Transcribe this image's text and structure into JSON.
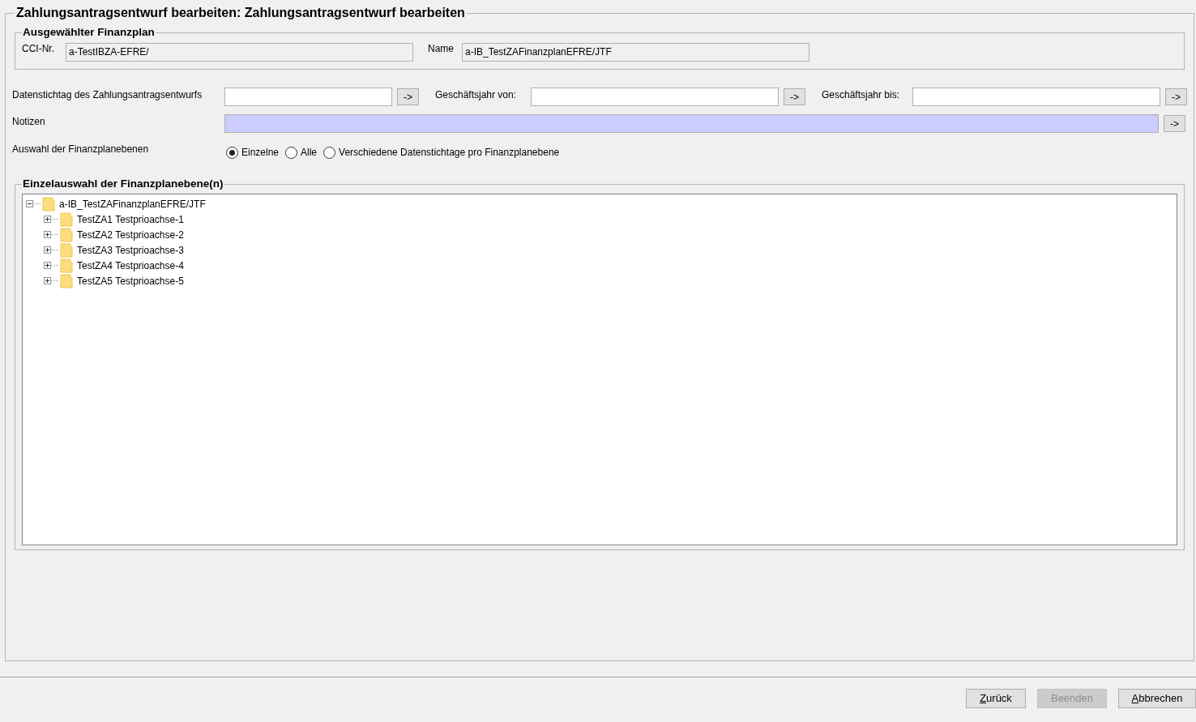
{
  "window": {
    "title": "Zahlungsantragsentwurf bearbeiten: Zahlungsantragsentwurf bearbeiten"
  },
  "selected_plan": {
    "title": "Ausgewählter Finanzplan",
    "cci_label": "CCI-Nr.",
    "cci_value": "a-TestIBZA-EFRE/",
    "name_label": "Name",
    "name_value": "a-IB_TestZAFinanzplanEFRE/JTF"
  },
  "fields": [
    {
      "label": "Datenstichtag des Zahlungsantragsentwurfs",
      "button": "->"
    },
    {
      "label": "Geschäftsjahr von:",
      "button": "->"
    },
    {
      "label": "Geschäftsjahr bis:",
      "button": "->"
    }
  ],
  "notes": {
    "label": "Notizen",
    "button": "->"
  },
  "level_selection": {
    "label": "Auswahl der Finanzplanebenen",
    "options": [
      {
        "label": "Einzelne",
        "selected": true
      },
      {
        "label": "Alle",
        "selected": false
      },
      {
        "label": "Verschiedene Datenstichtage pro Finanzplanebene",
        "selected": false
      }
    ]
  },
  "tree_panel": {
    "title": "Einzelauswahl der Finanzplanebene(n)",
    "tree": [
      {
        "label": "a-IB_TestZAFinanzplanEFRE/JTF",
        "expanded": true,
        "children": [
          {
            "label": "TestZA1 Testprioachse-1",
            "expanded": false
          },
          {
            "label": "TestZA2 Testprioachse-2",
            "expanded": false
          },
          {
            "label": "TestZA3 Testprioachse-3",
            "expanded": false
          },
          {
            "label": "TestZA4 Testprioachse-4",
            "expanded": false
          },
          {
            "label": "TestZA5 Testprioachse-5",
            "expanded": false
          }
        ]
      }
    ]
  },
  "buttons": [
    {
      "label": "Zurück",
      "disabled": false,
      "mnemonic": true
    },
    {
      "label": "Beenden",
      "disabled": true,
      "mnemonic": false
    },
    {
      "label": "Abbrechen",
      "disabled": false,
      "mnemonic": true
    }
  ]
}
